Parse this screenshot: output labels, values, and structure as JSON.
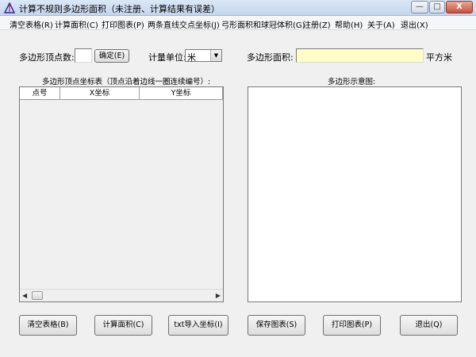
{
  "window": {
    "title": "计算不规则多边形面积（未注册、计算结果有误差）",
    "minimize": "—",
    "maximize": "□",
    "close": "X"
  },
  "menu": [
    "清空表格(R)",
    "计算面积(C)",
    "打印图表(P)",
    "两条直线交点坐标(J)",
    "弓形面积和球冠体积(G)",
    "注册(Z)",
    "帮助(H)",
    "关于(A)",
    "退出(X)"
  ],
  "vertex": {
    "label": "多边形顶点数:",
    "value": "",
    "confirm_button": "确定(E)"
  },
  "unit": {
    "label": "计量单位:",
    "selected": "米"
  },
  "area": {
    "label": "多边形面积:",
    "value": "",
    "unit": "平方米",
    "field_color": "#ffffc8"
  },
  "table": {
    "caption": "多边形顶点坐标表（顶点沿着边线一圈连续编号）:",
    "columns": [
      "点号",
      "X坐标",
      "Y坐标"
    ],
    "rows": []
  },
  "diagram": {
    "caption": "多边形示意图:"
  },
  "buttons": {
    "clear": "清空表格(B)",
    "compute": "计算面积(C)",
    "import": "txt导入坐标(I)",
    "save": "保存图表(S)",
    "print": "打印图表(P)",
    "exit": "退出(Q)"
  }
}
